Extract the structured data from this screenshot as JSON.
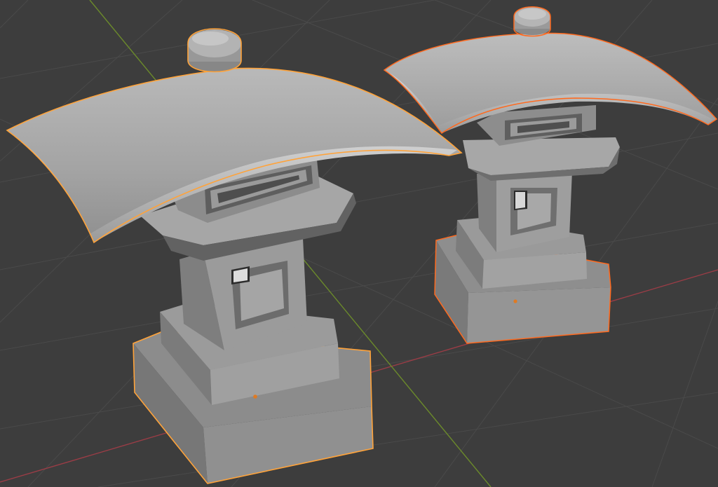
{
  "viewport": {
    "background": "#3d3d3d",
    "grid_color": "#4a4a4a",
    "x_axis_color": "#9a3d46",
    "y_axis_color": "#6b8a2b",
    "objects": [
      {
        "name": "stone-lantern-front",
        "selection": "active",
        "outline_color": "#ffa33a"
      },
      {
        "name": "stone-lantern-back",
        "selection": "selected",
        "outline_color": "#ff6a1f"
      }
    ],
    "origin_marker_color": "#e07a22"
  }
}
